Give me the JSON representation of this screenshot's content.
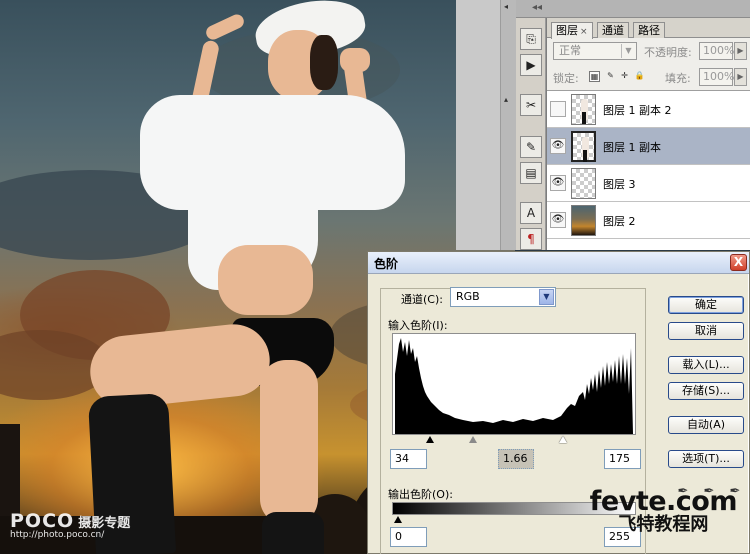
{
  "layers_panel": {
    "tabs": [
      {
        "label": "图层",
        "close": "×"
      },
      {
        "label": "通道"
      },
      {
        "label": "路径"
      }
    ],
    "blend_mode": "正常",
    "opacity_label": "不透明度:",
    "opacity_value": "100%",
    "lock_label": "锁定:",
    "fill_label": "填充:",
    "fill_value": "100%",
    "layers": [
      {
        "name": "图层 1 副本 2",
        "visible": false
      },
      {
        "name": "图层 1 副本",
        "visible": true,
        "selected": true
      },
      {
        "name": "图层 3",
        "visible": true
      },
      {
        "name": "图层 2",
        "visible": true
      }
    ]
  },
  "levels_dialog": {
    "title": "色阶",
    "close": "X",
    "channel_label": "通道(C):",
    "channel_value": "RGB",
    "input_label": "输入色阶(I):",
    "input_black": "34",
    "input_gamma": "1.66",
    "input_white": "175",
    "output_label": "输出色阶(O):",
    "output_black": "0",
    "output_white": "255",
    "buttons": {
      "ok": "确定",
      "cancel": "取消",
      "load": "载入(L)...",
      "save": "存储(S)...",
      "auto": "自动(A)",
      "options": "选项(T)..."
    }
  },
  "watermarks": {
    "poco": "POCO",
    "poco_tag": "摄影专题",
    "poco_url": "http://photo.poco.cn/",
    "fevte": "fevte.com",
    "fevte_cn": "飞特教程网"
  }
}
